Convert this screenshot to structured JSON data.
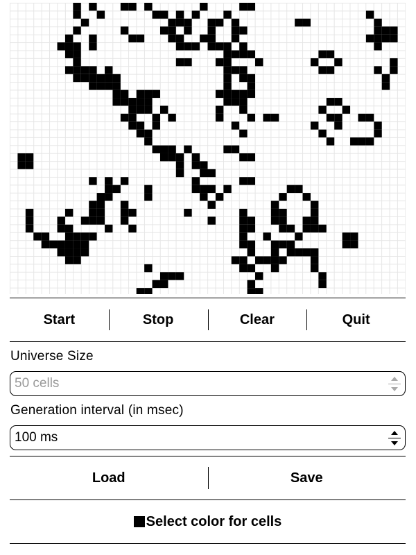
{
  "grid": {
    "cols": 50,
    "rows": 37,
    "cell_color": "#000000",
    "grid_line_color": "#e6e6e6",
    "live_cells": [
      [
        8,
        0
      ],
      [
        10,
        0
      ],
      [
        14,
        0
      ],
      [
        15,
        0
      ],
      [
        17,
        0
      ],
      [
        24,
        0
      ],
      [
        29,
        0
      ],
      [
        30,
        0
      ],
      [
        8,
        1
      ],
      [
        11,
        1
      ],
      [
        18,
        1
      ],
      [
        19,
        1
      ],
      [
        21,
        1
      ],
      [
        23,
        1
      ],
      [
        27,
        1
      ],
      [
        45,
        1
      ],
      [
        9,
        2
      ],
      [
        20,
        2
      ],
      [
        21,
        2
      ],
      [
        22,
        2
      ],
      [
        25,
        2
      ],
      [
        26,
        2
      ],
      [
        28,
        2
      ],
      [
        36,
        2
      ],
      [
        37,
        2
      ],
      [
        46,
        2
      ],
      [
        8,
        3
      ],
      [
        14,
        3
      ],
      [
        19,
        3
      ],
      [
        20,
        3
      ],
      [
        22,
        3
      ],
      [
        25,
        3
      ],
      [
        28,
        3
      ],
      [
        29,
        3
      ],
      [
        46,
        3
      ],
      [
        47,
        3
      ],
      [
        48,
        3
      ],
      [
        7,
        4
      ],
      [
        10,
        4
      ],
      [
        15,
        4
      ],
      [
        16,
        4
      ],
      [
        20,
        4
      ],
      [
        21,
        4
      ],
      [
        24,
        4
      ],
      [
        25,
        4
      ],
      [
        28,
        4
      ],
      [
        45,
        4
      ],
      [
        46,
        4
      ],
      [
        47,
        4
      ],
      [
        48,
        4
      ],
      [
        6,
        5
      ],
      [
        7,
        5
      ],
      [
        8,
        5
      ],
      [
        10,
        5
      ],
      [
        21,
        5
      ],
      [
        22,
        5
      ],
      [
        23,
        5
      ],
      [
        25,
        5
      ],
      [
        26,
        5
      ],
      [
        27,
        5
      ],
      [
        29,
        5
      ],
      [
        46,
        5
      ],
      [
        7,
        6
      ],
      [
        8,
        6
      ],
      [
        27,
        6
      ],
      [
        28,
        6
      ],
      [
        29,
        6
      ],
      [
        30,
        6
      ],
      [
        39,
        6
      ],
      [
        40,
        6
      ],
      [
        8,
        7
      ],
      [
        21,
        7
      ],
      [
        22,
        7
      ],
      [
        26,
        7
      ],
      [
        27,
        7
      ],
      [
        31,
        7
      ],
      [
        38,
        7
      ],
      [
        41,
        7
      ],
      [
        48,
        7
      ],
      [
        7,
        8
      ],
      [
        8,
        8
      ],
      [
        9,
        8
      ],
      [
        10,
        8
      ],
      [
        12,
        8
      ],
      [
        27,
        8
      ],
      [
        28,
        8
      ],
      [
        29,
        8
      ],
      [
        39,
        8
      ],
      [
        40,
        8
      ],
      [
        46,
        8
      ],
      [
        48,
        8
      ],
      [
        8,
        9
      ],
      [
        9,
        9
      ],
      [
        10,
        9
      ],
      [
        11,
        9
      ],
      [
        12,
        9
      ],
      [
        13,
        9
      ],
      [
        27,
        9
      ],
      [
        29,
        9
      ],
      [
        30,
        9
      ],
      [
        47,
        9
      ],
      [
        10,
        10
      ],
      [
        11,
        10
      ],
      [
        12,
        10
      ],
      [
        13,
        10
      ],
      [
        27,
        10
      ],
      [
        30,
        10
      ],
      [
        47,
        10
      ],
      [
        13,
        11
      ],
      [
        14,
        11
      ],
      [
        16,
        11
      ],
      [
        17,
        11
      ],
      [
        18,
        11
      ],
      [
        26,
        11
      ],
      [
        27,
        11
      ],
      [
        28,
        11
      ],
      [
        29,
        11
      ],
      [
        30,
        11
      ],
      [
        13,
        12
      ],
      [
        14,
        12
      ],
      [
        15,
        12
      ],
      [
        16,
        12
      ],
      [
        17,
        12
      ],
      [
        27,
        12
      ],
      [
        28,
        12
      ],
      [
        29,
        12
      ],
      [
        40,
        12
      ],
      [
        41,
        12
      ],
      [
        15,
        13
      ],
      [
        16,
        13
      ],
      [
        17,
        13
      ],
      [
        19,
        13
      ],
      [
        26,
        13
      ],
      [
        29,
        13
      ],
      [
        39,
        13
      ],
      [
        42,
        13
      ],
      [
        14,
        14
      ],
      [
        15,
        14
      ],
      [
        18,
        14
      ],
      [
        20,
        14
      ],
      [
        26,
        14
      ],
      [
        30,
        14
      ],
      [
        32,
        14
      ],
      [
        33,
        14
      ],
      [
        40,
        14
      ],
      [
        41,
        14
      ],
      [
        44,
        14
      ],
      [
        45,
        14
      ],
      [
        15,
        15
      ],
      [
        16,
        15
      ],
      [
        18,
        15
      ],
      [
        28,
        15
      ],
      [
        38,
        15
      ],
      [
        41,
        15
      ],
      [
        46,
        15
      ],
      [
        16,
        16
      ],
      [
        17,
        16
      ],
      [
        29,
        16
      ],
      [
        39,
        16
      ],
      [
        46,
        16
      ],
      [
        17,
        17
      ],
      [
        40,
        17
      ],
      [
        43,
        17
      ],
      [
        44,
        17
      ],
      [
        45,
        17
      ],
      [
        18,
        18
      ],
      [
        19,
        18
      ],
      [
        20,
        18
      ],
      [
        22,
        18
      ],
      [
        27,
        18
      ],
      [
        28,
        18
      ],
      [
        1,
        19
      ],
      [
        2,
        19
      ],
      [
        19,
        19
      ],
      [
        20,
        19
      ],
      [
        21,
        19
      ],
      [
        23,
        19
      ],
      [
        29,
        19
      ],
      [
        30,
        19
      ],
      [
        1,
        20
      ],
      [
        2,
        20
      ],
      [
        21,
        20
      ],
      [
        23,
        20
      ],
      [
        24,
        20
      ],
      [
        21,
        21
      ],
      [
        24,
        21
      ],
      [
        25,
        21
      ],
      [
        10,
        22
      ],
      [
        12,
        22
      ],
      [
        14,
        22
      ],
      [
        23,
        22
      ],
      [
        29,
        22
      ],
      [
        30,
        22
      ],
      [
        12,
        23
      ],
      [
        13,
        23
      ],
      [
        17,
        23
      ],
      [
        23,
        23
      ],
      [
        24,
        23
      ],
      [
        25,
        23
      ],
      [
        27,
        23
      ],
      [
        35,
        23
      ],
      [
        36,
        23
      ],
      [
        11,
        24
      ],
      [
        12,
        24
      ],
      [
        17,
        24
      ],
      [
        24,
        24
      ],
      [
        26,
        24
      ],
      [
        34,
        24
      ],
      [
        37,
        24
      ],
      [
        10,
        25
      ],
      [
        11,
        25
      ],
      [
        14,
        25
      ],
      [
        25,
        25
      ],
      [
        33,
        25
      ],
      [
        38,
        25
      ],
      [
        2,
        26
      ],
      [
        7,
        26
      ],
      [
        10,
        26
      ],
      [
        11,
        26
      ],
      [
        14,
        26
      ],
      [
        15,
        26
      ],
      [
        22,
        26
      ],
      [
        29,
        26
      ],
      [
        33,
        26
      ],
      [
        34,
        26
      ],
      [
        38,
        26
      ],
      [
        2,
        27
      ],
      [
        6,
        27
      ],
      [
        9,
        27
      ],
      [
        10,
        27
      ],
      [
        11,
        27
      ],
      [
        14,
        27
      ],
      [
        25,
        27
      ],
      [
        29,
        27
      ],
      [
        30,
        27
      ],
      [
        33,
        27
      ],
      [
        34,
        27
      ],
      [
        37,
        27
      ],
      [
        38,
        27
      ],
      [
        2,
        28
      ],
      [
        6,
        28
      ],
      [
        7,
        28
      ],
      [
        12,
        28
      ],
      [
        15,
        28
      ],
      [
        29,
        28
      ],
      [
        30,
        28
      ],
      [
        34,
        28
      ],
      [
        35,
        28
      ],
      [
        37,
        28
      ],
      [
        38,
        28
      ],
      [
        39,
        28
      ],
      [
        3,
        29
      ],
      [
        4,
        29
      ],
      [
        7,
        29
      ],
      [
        8,
        29
      ],
      [
        9,
        29
      ],
      [
        10,
        29
      ],
      [
        29,
        29
      ],
      [
        32,
        29
      ],
      [
        36,
        29
      ],
      [
        42,
        29
      ],
      [
        43,
        29
      ],
      [
        4,
        30
      ],
      [
        5,
        30
      ],
      [
        6,
        30
      ],
      [
        7,
        30
      ],
      [
        8,
        30
      ],
      [
        9,
        30
      ],
      [
        29,
        30
      ],
      [
        30,
        30
      ],
      [
        33,
        30
      ],
      [
        34,
        30
      ],
      [
        35,
        30
      ],
      [
        42,
        30
      ],
      [
        43,
        30
      ],
      [
        6,
        31
      ],
      [
        7,
        31
      ],
      [
        8,
        31
      ],
      [
        9,
        31
      ],
      [
        30,
        31
      ],
      [
        33,
        31
      ],
      [
        35,
        31
      ],
      [
        36,
        31
      ],
      [
        37,
        31
      ],
      [
        38,
        31
      ],
      [
        7,
        32
      ],
      [
        8,
        32
      ],
      [
        28,
        32
      ],
      [
        29,
        32
      ],
      [
        31,
        32
      ],
      [
        32,
        32
      ],
      [
        33,
        32
      ],
      [
        34,
        32
      ],
      [
        38,
        32
      ],
      [
        17,
        33
      ],
      [
        29,
        33
      ],
      [
        30,
        33
      ],
      [
        33,
        33
      ],
      [
        38,
        33
      ],
      [
        19,
        34
      ],
      [
        20,
        34
      ],
      [
        21,
        34
      ],
      [
        31,
        34
      ],
      [
        39,
        34
      ],
      [
        18,
        35
      ],
      [
        19,
        35
      ],
      [
        30,
        35
      ],
      [
        39,
        35
      ],
      [
        16,
        36
      ],
      [
        17,
        36
      ],
      [
        30,
        36
      ],
      [
        31,
        36
      ],
      [
        15,
        37
      ],
      [
        16,
        37
      ],
      [
        17,
        37
      ]
    ]
  },
  "controls": {
    "start": "Start",
    "stop": "Stop",
    "clear": "Clear",
    "quit": "Quit"
  },
  "universe_size": {
    "label": "Universe Size",
    "placeholder": "50 cells",
    "value": ""
  },
  "generation_interval": {
    "label": "Generation interval (in msec)",
    "value": "100 ms"
  },
  "file": {
    "load": "Load",
    "save": "Save"
  },
  "color_button": {
    "label": "Select color for cells",
    "swatch_color": "#000000"
  }
}
